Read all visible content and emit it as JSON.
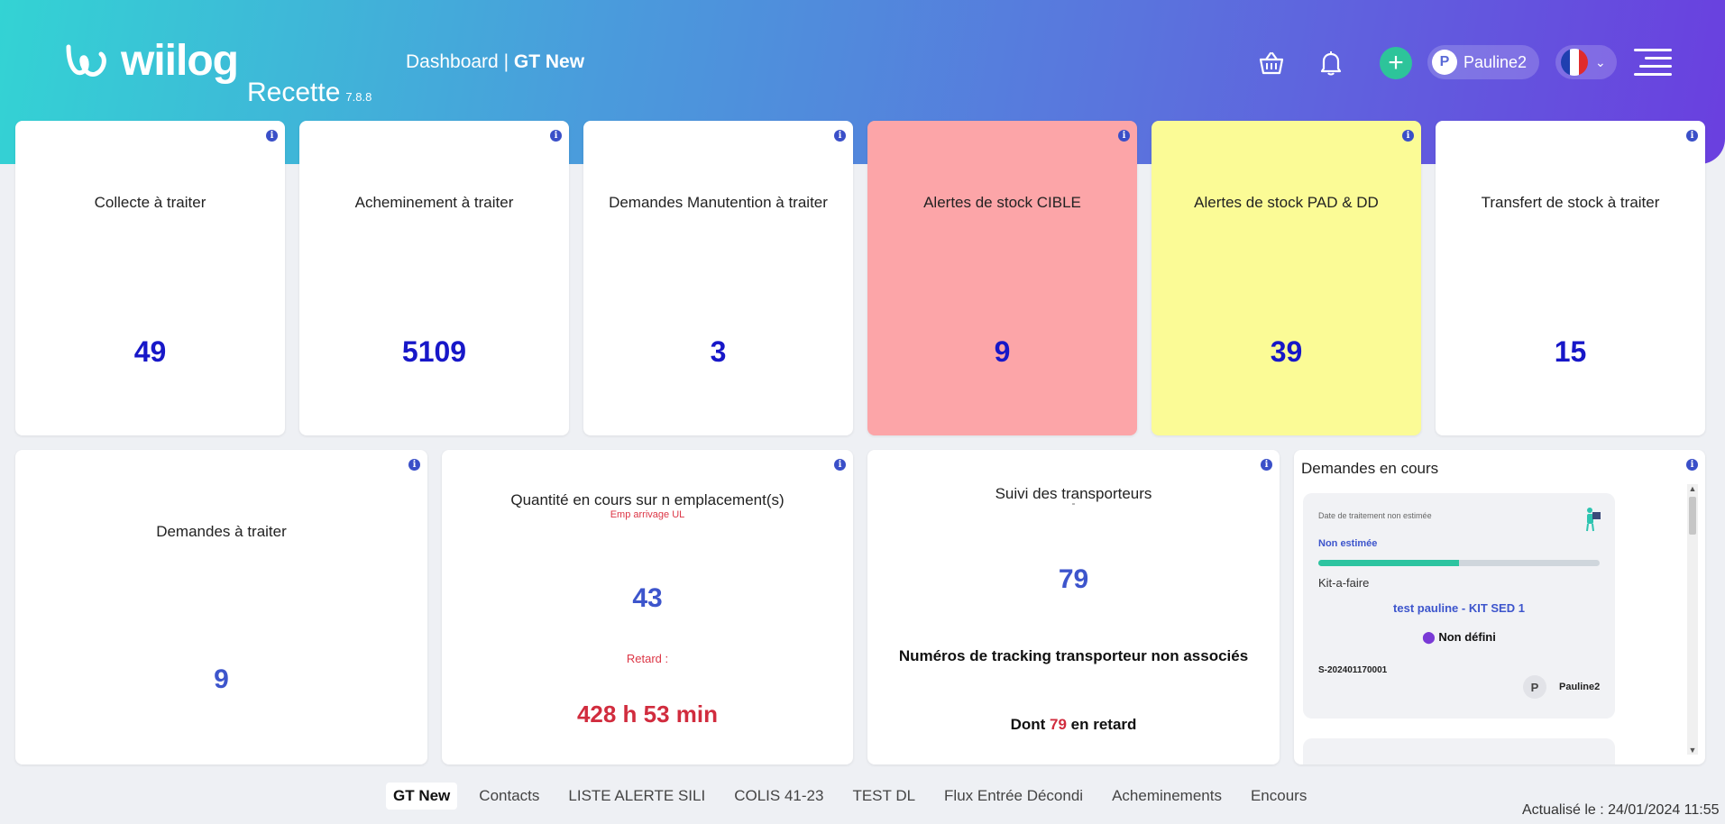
{
  "header": {
    "logo_text": "wiilog",
    "environment": "Recette",
    "version": "7.8.8",
    "breadcrumb_prefix": "Dashboard |",
    "breadcrumb_current": "GT New",
    "user_initial": "P",
    "user_name": "Pauline2",
    "brand_color": "#5a74dd"
  },
  "icons": [
    "basket-icon",
    "bell-icon",
    "plus-icon",
    "flag-fr-icon",
    "chevron-down-icon",
    "hamburger-menu-icon",
    "info-icon"
  ],
  "cards_top": [
    {
      "title": "Collecte à traiter",
      "value": "49"
    },
    {
      "title": "Acheminement à traiter",
      "value": "5109"
    },
    {
      "title": "Demandes Manutention à traiter",
      "value": "3"
    },
    {
      "title": "Alertes de stock CIBLE",
      "value": "9",
      "bg": "#fca5a8"
    },
    {
      "title": "Alertes de stock PAD & DD",
      "value": "39",
      "bg": "#fbfb96"
    },
    {
      "title": "Transfert de stock à traiter",
      "value": "15"
    }
  ],
  "card_demandes": {
    "title": "Demandes à traiter",
    "value": "9"
  },
  "card_quantite": {
    "title": "Quantité en cours sur n emplacement(s)",
    "subtitle": "Emp arrivage UL",
    "value": "43",
    "delay_label": "Retard :",
    "delay_value": "428 h 53 min"
  },
  "card_transport": {
    "title": "Suivi des transporteurs",
    "dot": "-",
    "value": "79",
    "description": "Numéros de tracking transporteur non associés",
    "late_prefix": "Dont",
    "late_count": "79",
    "late_suffix": "en retard"
  },
  "card_en_cours": {
    "title": "Demandes en cours",
    "item": {
      "date_label": "Date de traitement non estimée",
      "estimate": "Non estimée",
      "progress": 0.5,
      "type": "Kit-a-faire",
      "name": "test pauline - KIT SED 1",
      "location": "Non défini",
      "number": "S-202401170001",
      "user_initial": "P",
      "user_name": "Pauline2"
    }
  },
  "footer": {
    "tabs": [
      "GT New",
      "Contacts",
      "LISTE ALERTE SILI",
      "COLIS 41-23",
      "TEST DL",
      "Flux Entrée Décondi",
      "Acheminements",
      "Encours"
    ],
    "active_tab": "GT New",
    "updated": "Actualisé le : 24/01/2024 11:55"
  }
}
